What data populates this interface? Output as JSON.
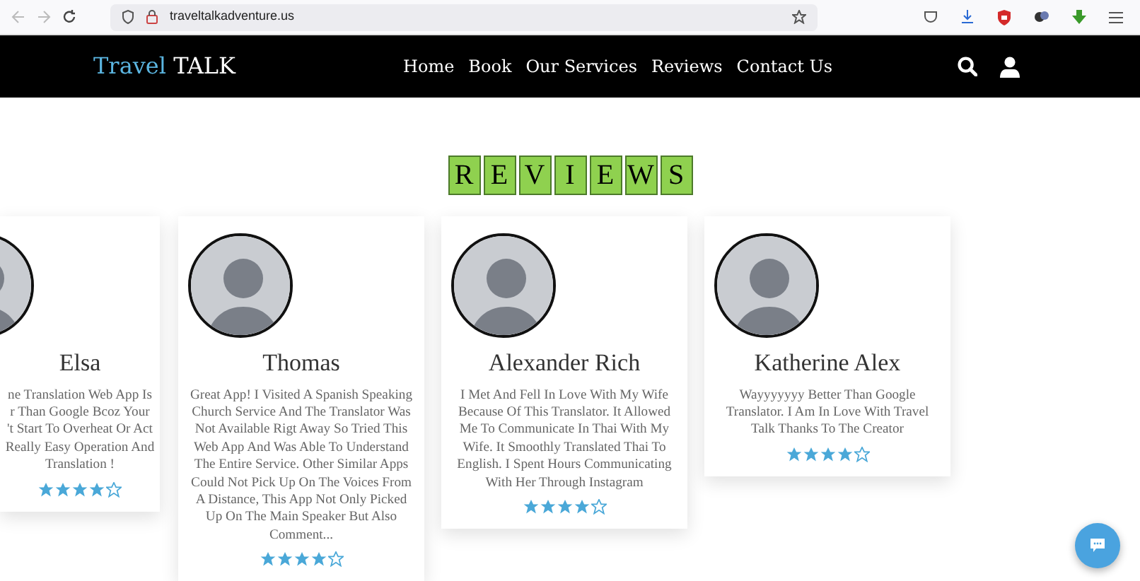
{
  "browser": {
    "url": "traveltalkadventure.us"
  },
  "navbar": {
    "brand_first": "Travel",
    "brand_second": "TALK",
    "links": [
      {
        "label": "Home"
      },
      {
        "label": "Book"
      },
      {
        "label": "Our Services"
      },
      {
        "label": "Reviews"
      },
      {
        "label": "Contact Us"
      }
    ]
  },
  "section_title_tiles": [
    "R",
    "E",
    "V",
    "I",
    "E",
    "W",
    "S"
  ],
  "reviews": [
    {
      "name": "Elsa",
      "text_lines": [
        "ne Translation Web App Is",
        "r Than Google Bcoz Your",
        "'t Start To Overheat Or Act",
        "Really Easy Operation And",
        "Translation !"
      ],
      "stars": 4,
      "kind": "partial"
    },
    {
      "name": "Thomas",
      "text": "Great App! I Visited A Spanish Speaking Church Service And The Translator Was Not Available Rigt Away So Tried This Web App And Was Able To Understand The Entire Service. Other Similar Apps Could Not Pick Up On The Voices From A Distance, This App Not Only Picked Up On The Main Speaker But Also Comment...",
      "stars": 4,
      "kind": "full"
    },
    {
      "name": "Alexander Rich",
      "text": "I Met And Fell In Love With My Wife Because Of This Translator. It Allowed Me To Communicate In Thai With My Wife. It Smoothly Translated Thai To English. I Spent Hours Communicating With Her Through Instagram",
      "stars": 4,
      "kind": "full"
    },
    {
      "name": "Katherine Alex",
      "text": "Wayyyyyyy Better Than Google Translator. I Am In Love With Travel Talk Thanks To The Creator",
      "stars": 4,
      "kind": "full"
    }
  ]
}
